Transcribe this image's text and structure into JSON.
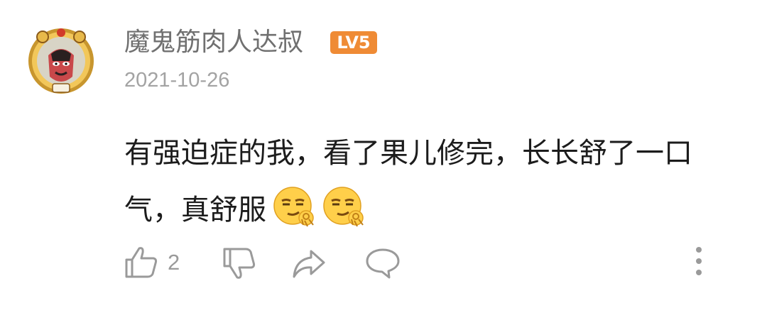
{
  "comment": {
    "author": "魔鬼筋肉人达叔",
    "level_badge": "LV5",
    "date": "2021-10-26",
    "text": "有强迫症的我，看了果儿修完，长长舒了一口气，真舒服",
    "emojis": [
      "smirk-ok-emoji",
      "smirk-ok-emoji"
    ],
    "like_count": "2"
  },
  "icons": {
    "like": "thumbs-up-icon",
    "dislike": "thumbs-down-icon",
    "share": "share-icon",
    "reply": "comment-bubble-icon",
    "more": "more-vertical-icon"
  },
  "colors": {
    "badge": "#ef8b35",
    "username": "#707070",
    "date": "#a3a3a3",
    "text": "#1c1c1c",
    "icon": "#9a9a9a"
  }
}
